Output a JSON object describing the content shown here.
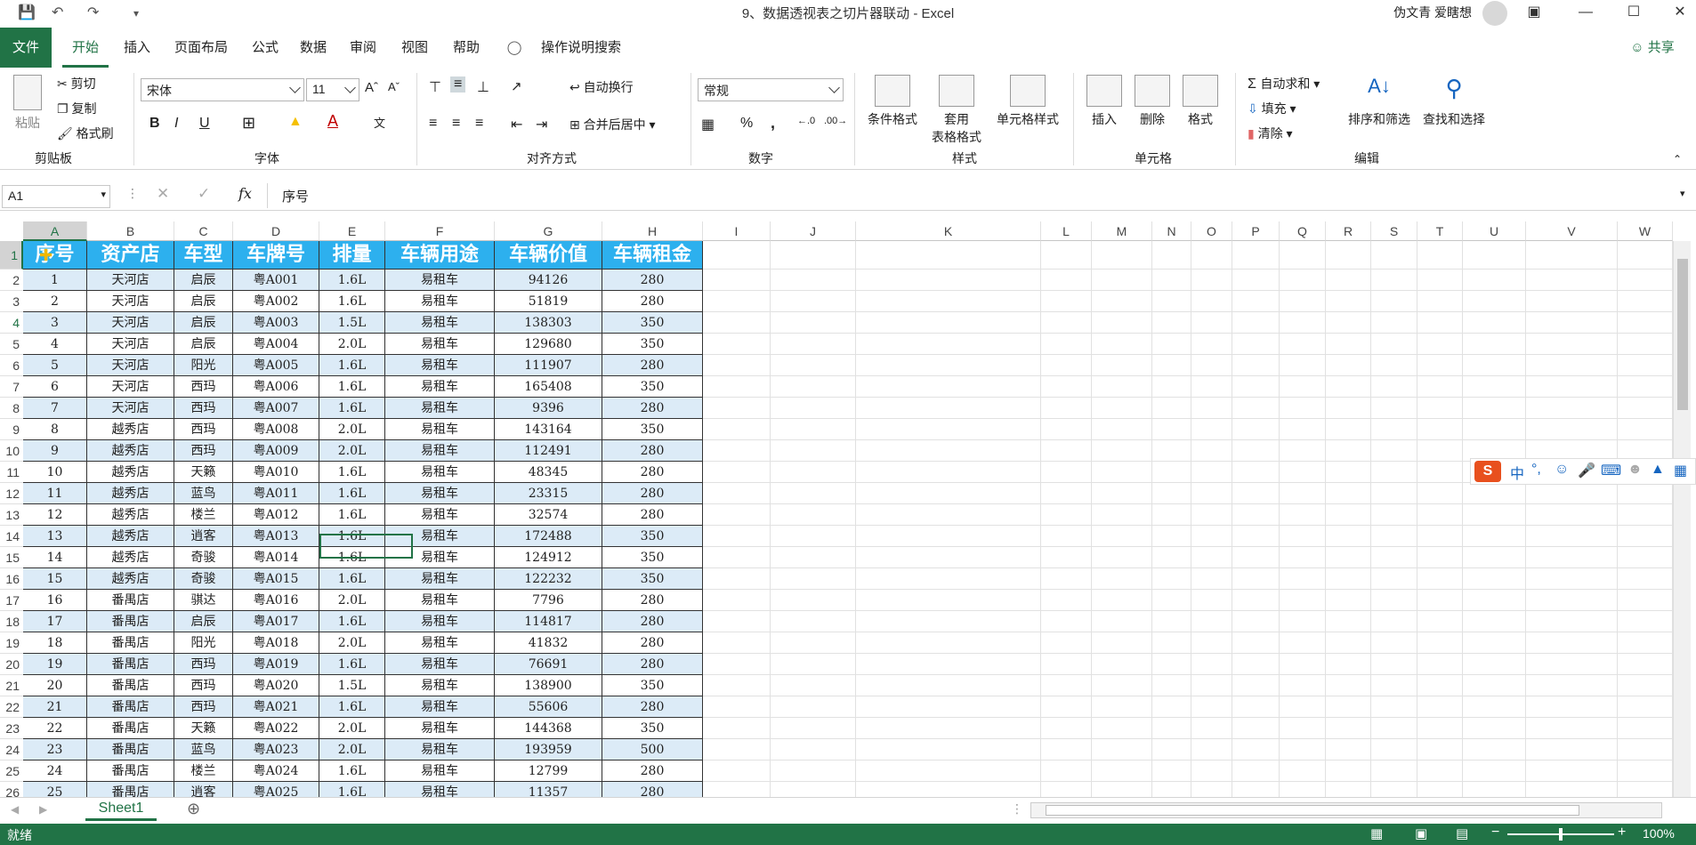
{
  "window": {
    "title": "9、数据透视表之切片器联动  -  Excel",
    "user": "伪文青 爱瞎想"
  },
  "tabs": [
    "文件",
    "开始",
    "插入",
    "页面布局",
    "公式",
    "数据",
    "审阅",
    "视图",
    "帮助",
    "操作说明搜索"
  ],
  "share": "共享",
  "ribbon": {
    "clipboard": {
      "paste": "粘贴",
      "cut": "剪切",
      "copy": "复制",
      "format_painter": "格式刷",
      "group": "剪贴板"
    },
    "font": {
      "name": "宋体",
      "size": "11",
      "group": "字体",
      "bold": "B",
      "italic": "I",
      "underline": "U"
    },
    "align": {
      "wrap": "自动换行",
      "merge": "合并后居中",
      "group": "对齐方式"
    },
    "number": {
      "format": "常规",
      "group": "数字",
      "percent": "%",
      "comma": ","
    },
    "styles": {
      "cond": "条件格式",
      "table_a": "套用",
      "table_b": "表格格式",
      "cell": "单元格样式",
      "group": "样式"
    },
    "cells": {
      "insert": "插入",
      "delete": "删除",
      "format": "格式",
      "group": "单元格"
    },
    "edit": {
      "autosum": "自动求和",
      "fill": "填充",
      "clear": "清除",
      "sort": "排序和筛选",
      "find": "查找和选择",
      "group": "编辑"
    }
  },
  "formula_bar": {
    "name_box": "A1",
    "content": "序号"
  },
  "columns": [
    "A",
    "B",
    "C",
    "D",
    "E",
    "F",
    "G",
    "H",
    "I",
    "J",
    "K",
    "L",
    "M",
    "N",
    "O",
    "P",
    "Q",
    "R",
    "S",
    "T",
    "U",
    "V",
    "W"
  ],
  "headers": [
    "序号",
    "资产店",
    "车型",
    "车牌号",
    "排量",
    "车辆用途",
    "车辆价值",
    "车辆租金"
  ],
  "rows": [
    [
      "1",
      "天河店",
      "启辰",
      "粤A001",
      "1.6L",
      "易租车",
      "94126",
      "280"
    ],
    [
      "2",
      "天河店",
      "启辰",
      "粤A002",
      "1.6L",
      "易租车",
      "51819",
      "280"
    ],
    [
      "3",
      "天河店",
      "启辰",
      "粤A003",
      "1.5L",
      "易租车",
      "138303",
      "350"
    ],
    [
      "4",
      "天河店",
      "启辰",
      "粤A004",
      "2.0L",
      "易租车",
      "129680",
      "350"
    ],
    [
      "5",
      "天河店",
      "阳光",
      "粤A005",
      "1.6L",
      "易租车",
      "111907",
      "280"
    ],
    [
      "6",
      "天河店",
      "西玛",
      "粤A006",
      "1.6L",
      "易租车",
      "165408",
      "350"
    ],
    [
      "7",
      "天河店",
      "西玛",
      "粤A007",
      "1.6L",
      "易租车",
      "9396",
      "280"
    ],
    [
      "8",
      "越秀店",
      "西玛",
      "粤A008",
      "2.0L",
      "易租车",
      "143164",
      "350"
    ],
    [
      "9",
      "越秀店",
      "西玛",
      "粤A009",
      "2.0L",
      "易租车",
      "112491",
      "280"
    ],
    [
      "10",
      "越秀店",
      "天籁",
      "粤A010",
      "1.6L",
      "易租车",
      "48345",
      "280"
    ],
    [
      "11",
      "越秀店",
      "蓝鸟",
      "粤A011",
      "1.6L",
      "易租车",
      "23315",
      "280"
    ],
    [
      "12",
      "越秀店",
      "楼兰",
      "粤A012",
      "1.6L",
      "易租车",
      "32574",
      "280"
    ],
    [
      "13",
      "越秀店",
      "逍客",
      "粤A013",
      "1.6L",
      "易租车",
      "172488",
      "350"
    ],
    [
      "14",
      "越秀店",
      "奇骏",
      "粤A014",
      "1.6L",
      "易租车",
      "124912",
      "350"
    ],
    [
      "15",
      "越秀店",
      "奇骏",
      "粤A015",
      "1.6L",
      "易租车",
      "122232",
      "350"
    ],
    [
      "16",
      "番禺店",
      "骐达",
      "粤A016",
      "2.0L",
      "易租车",
      "7796",
      "280"
    ],
    [
      "17",
      "番禺店",
      "启辰",
      "粤A017",
      "1.6L",
      "易租车",
      "114817",
      "280"
    ],
    [
      "18",
      "番禺店",
      "阳光",
      "粤A018",
      "2.0L",
      "易租车",
      "41832",
      "280"
    ],
    [
      "19",
      "番禺店",
      "西玛",
      "粤A019",
      "1.6L",
      "易租车",
      "76691",
      "280"
    ],
    [
      "20",
      "番禺店",
      "西玛",
      "粤A020",
      "1.5L",
      "易租车",
      "138900",
      "350"
    ],
    [
      "21",
      "番禺店",
      "西玛",
      "粤A021",
      "1.6L",
      "易租车",
      "55606",
      "280"
    ],
    [
      "22",
      "番禺店",
      "天籁",
      "粤A022",
      "2.0L",
      "易租车",
      "144368",
      "350"
    ],
    [
      "23",
      "番禺店",
      "蓝鸟",
      "粤A023",
      "2.0L",
      "易租车",
      "193959",
      "500"
    ],
    [
      "24",
      "番禺店",
      "楼兰",
      "粤A024",
      "1.6L",
      "易租车",
      "12799",
      "280"
    ],
    [
      "25",
      "番禺店",
      "逍客",
      "粤A025",
      "1.6L",
      "易租车",
      "11357",
      "280"
    ]
  ],
  "sheet": {
    "tab": "Sheet1"
  },
  "status": {
    "text": "就绪",
    "zoom": "100%"
  },
  "ime": {
    "label": "中"
  },
  "colors": {
    "accent": "#217346",
    "header_fill": "#2db0ee",
    "band_fill": "#dcebf7"
  }
}
